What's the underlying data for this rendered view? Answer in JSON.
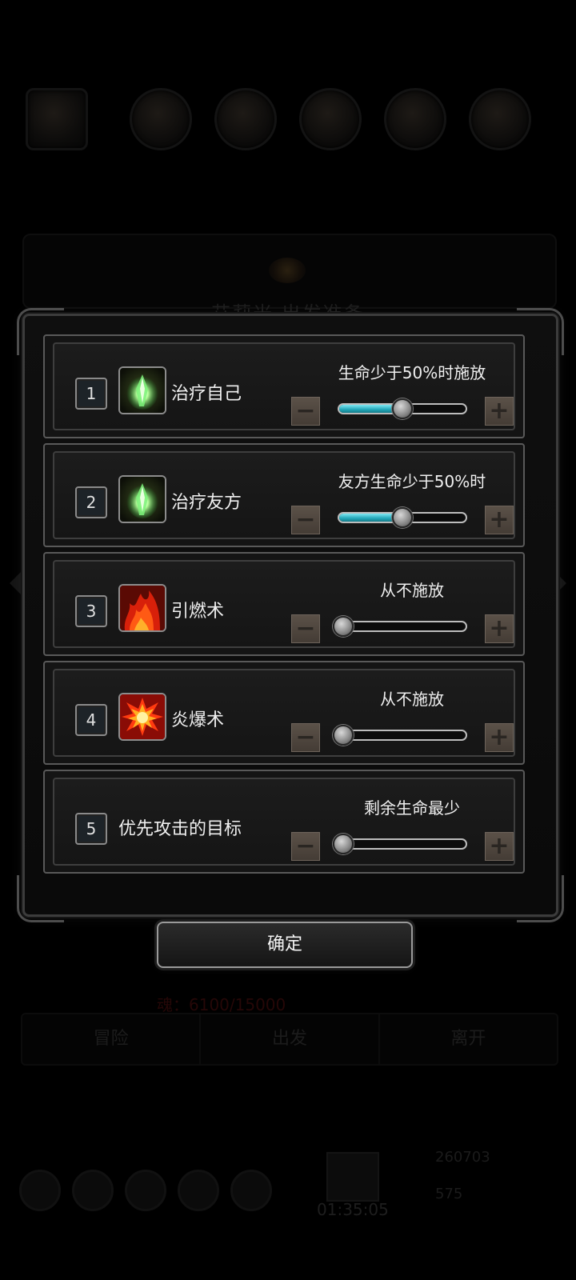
{
  "background": {
    "title": "艾莉米 出发准备",
    "soul": "魂：6100/15000",
    "tabs": [
      "冒险",
      "出发",
      "离开"
    ],
    "timer": "01:35:05",
    "gold": "260703",
    "gems": "575"
  },
  "rows": [
    {
      "number": "1",
      "name": "治疗自己",
      "icon": "green-crystal-heal-icon",
      "condition": "生命少于50%时施放",
      "level": 0.5
    },
    {
      "number": "2",
      "name": "治疗友方",
      "icon": "green-crystal-heal-icon",
      "condition": "友方生命少于50%时",
      "level": 0.5
    },
    {
      "number": "3",
      "name": "引燃术",
      "icon": "flame-ignite-icon",
      "condition": "从不施放",
      "level": 0
    },
    {
      "number": "4",
      "name": "炎爆术",
      "icon": "fire-explosion-icon",
      "condition": "从不施放",
      "level": 0
    },
    {
      "number": "5",
      "name": "优先攻击的目标",
      "icon": null,
      "condition": "剩余生命最少",
      "level": 0
    }
  ],
  "confirm_label": "确定",
  "colors": {
    "slider_fill": "#21a6b8",
    "button_bg": "#5b5148",
    "frame": "#595959"
  }
}
